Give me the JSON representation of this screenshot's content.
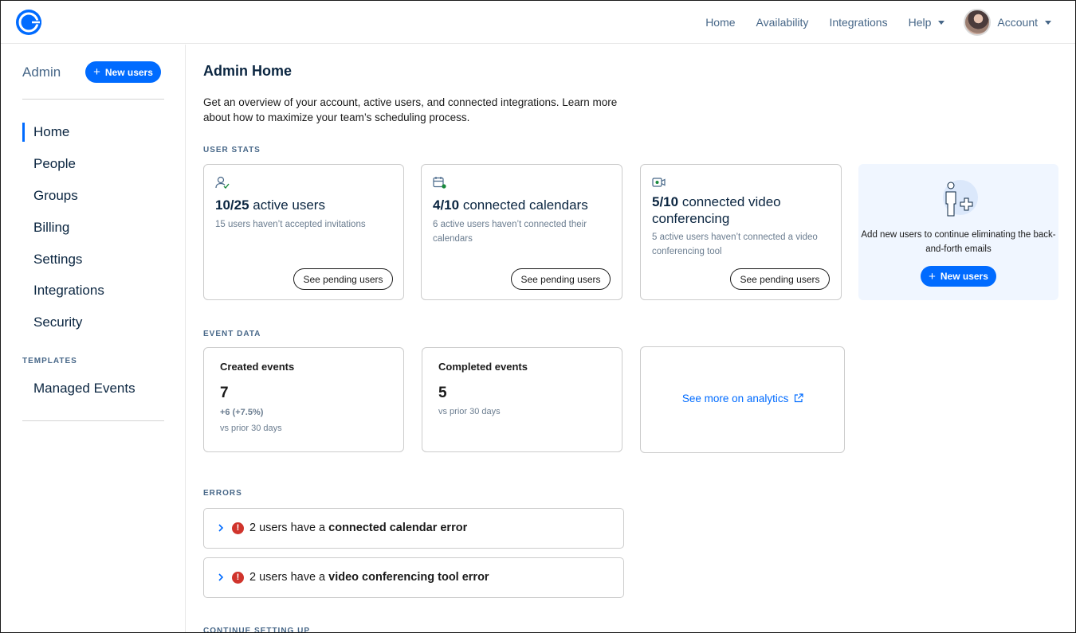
{
  "topnav": {
    "items": [
      "Home",
      "Availability",
      "Integrations",
      "Help"
    ],
    "account_label": "Account"
  },
  "sidebar": {
    "title": "Admin",
    "new_users_label": "New users",
    "items": [
      "Home",
      "People",
      "Groups",
      "Billing",
      "Settings",
      "Integrations",
      "Security"
    ],
    "active_item": "Home",
    "templates_label": "TEMPLATES",
    "templates_items": [
      "Managed Events"
    ]
  },
  "main": {
    "title": "Admin Home",
    "description": "Get an overview of your account, active users, and connected integrations. Learn more about how to maximize your team’s scheduling process.",
    "user_stats_label": "USER STATS",
    "user_stats": [
      {
        "bold": "10/25",
        "rest": " active users",
        "sub": "15 users haven’t accepted invitations",
        "button": "See pending users",
        "icon": "user-check-icon"
      },
      {
        "bold": "4/10",
        "rest": " connected calendars",
        "sub": "6 active users haven’t connected their calendars",
        "button": "See pending users",
        "icon": "calendar-icon"
      },
      {
        "bold": "5/10",
        "rest": " connected video conferencing",
        "sub": "5 active users haven’t connected a video conferencing tool",
        "button": "See pending users",
        "icon": "video-icon"
      }
    ],
    "promo": {
      "text": "Add new users to continue eliminating the back-and-forth emails",
      "button": "New users"
    },
    "event_data_label": "EVENT DATA",
    "events": [
      {
        "title": "Created events",
        "value": "7",
        "delta": "+6 (+7.5%)",
        "vs": "vs prior 30 days"
      },
      {
        "title": "Completed events",
        "value": "5",
        "vs": "vs prior 30 days"
      }
    ],
    "analytics_link": "See more on analytics",
    "errors_label": "ERRORS",
    "errors": [
      {
        "prefix": "2 users have a ",
        "bold": "connected calendar error"
      },
      {
        "prefix": "2 users have a ",
        "bold": "video conferencing tool error"
      }
    ],
    "continue_label": "CONTINUE SETTING UP"
  },
  "colors": {
    "brand_blue": "#006bff",
    "text_dark": "#0a2540",
    "text_muted": "#476788",
    "error_red": "#d0342c",
    "promo_bg": "#f0f6ff"
  }
}
